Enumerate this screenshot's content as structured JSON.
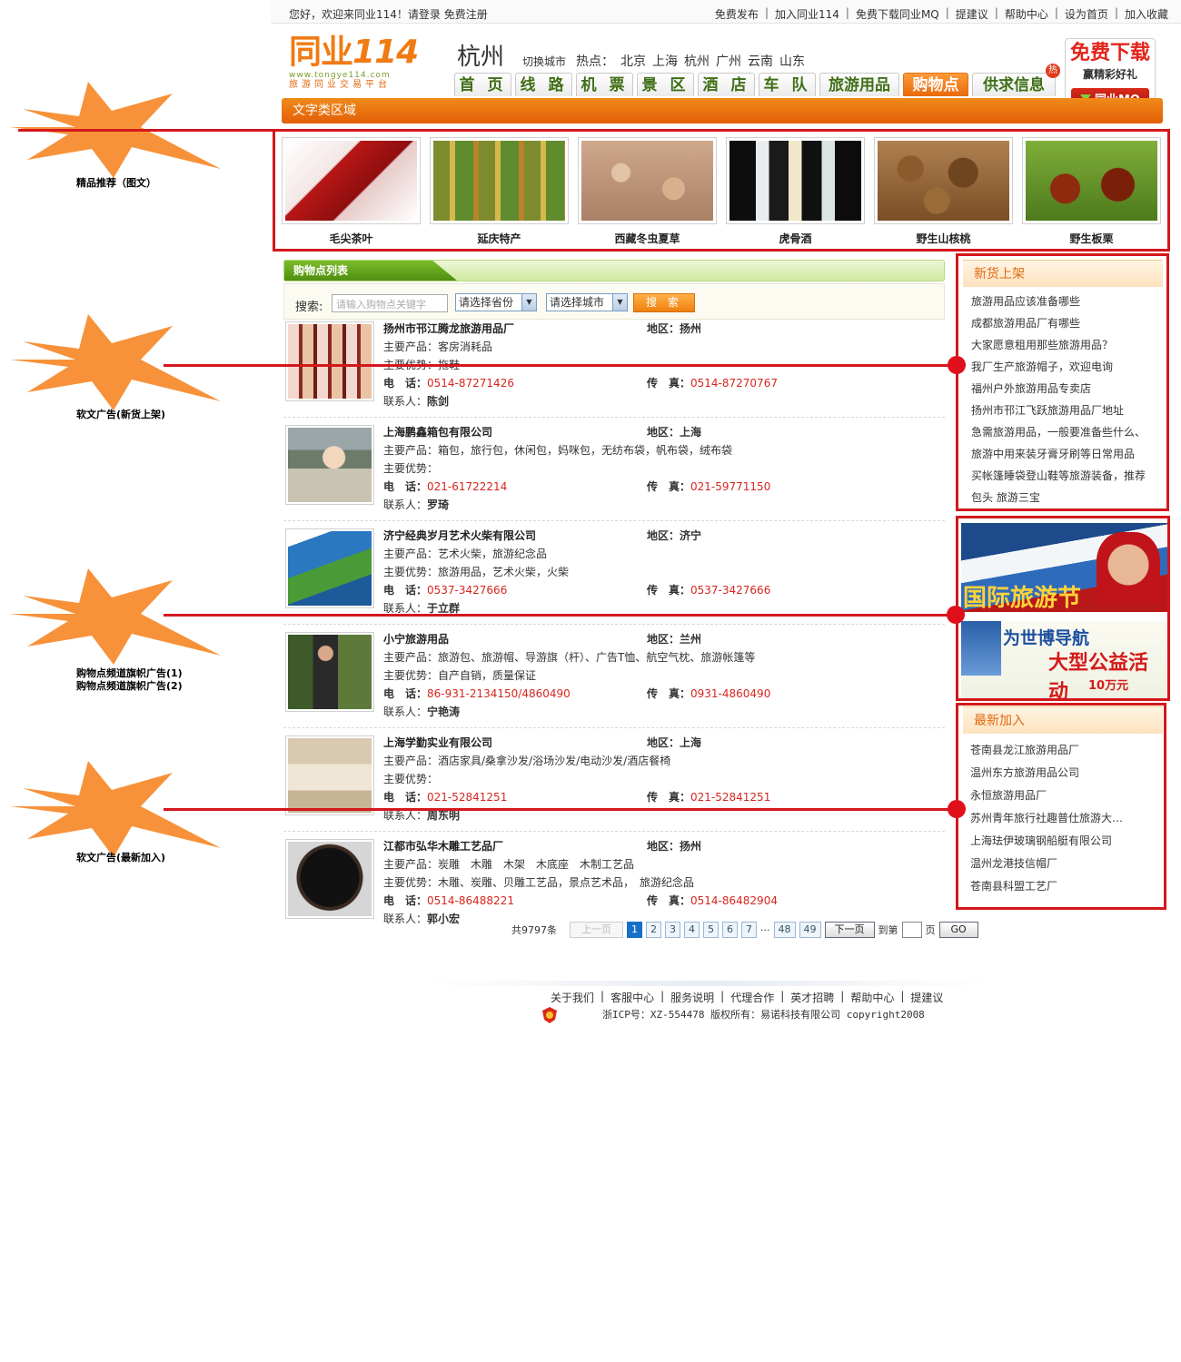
{
  "annotations": [
    {
      "label": "精品推荐（图文）"
    },
    {
      "label": "软文广告(新货上架)"
    },
    {
      "label": "购物点频道旗帜广告(1)"
    },
    {
      "label": "购物点频道旗帜广告(2)"
    },
    {
      "label": "软文广告(最新加入)"
    }
  ],
  "topbar": {
    "welcome": "您好，欢迎来同业114！请登录 免费注册",
    "links": [
      "免费发布",
      "加入同业114",
      "免费下载同业MQ",
      "提建议",
      "帮助中心",
      "设为首页",
      "加入收藏"
    ]
  },
  "header": {
    "logo_cn": "同业",
    "logo_num": "114",
    "logo_url": "www.tongye114.com",
    "logo_slogan": "旅游同业交易平台",
    "city": "杭州",
    "switch_city": "切换城市",
    "hot_label": "热点：",
    "hot_cities": [
      "北京",
      "上海",
      "杭州",
      "广州",
      "云南",
      "山东"
    ],
    "hot_badge": "热"
  },
  "nav": {
    "tabs": [
      "首 页",
      "线 路",
      "机 票",
      "景 区",
      "酒 店",
      "车 队",
      "旅游用品",
      "购物点",
      "供求信息"
    ],
    "active": "购物点"
  },
  "promo": {
    "title": "免费下载",
    "subtitle": "赢精彩好礼",
    "button": "同业MQ"
  },
  "text_area_title": "文字类区域",
  "featured": [
    {
      "name": "毛尖茶叶"
    },
    {
      "name": "延庆特产"
    },
    {
      "name": "西藏冬虫夏草"
    },
    {
      "name": "虎骨酒"
    },
    {
      "name": "野生山核桃"
    },
    {
      "name": "野生板栗"
    }
  ],
  "list": {
    "title": "购物点列表",
    "search_label": "搜索:",
    "search_placeholder": "请输入购物点关键字",
    "province_select": "请选择省份",
    "city_select": "请选择城市",
    "search_button": "搜 索",
    "labels": {
      "region": "地区：",
      "products": "主要产品：",
      "advantage": "主要优势：",
      "phone": "电　话：",
      "fax": "传　真：",
      "contact": "联系人："
    },
    "items": [
      {
        "name": "扬州市邗江腾龙旅游用品厂",
        "region": "扬州",
        "products": "客房消耗品",
        "advantage": "拖鞋",
        "phone": "0514-87271426",
        "fax": "0514-87270767",
        "contact": "陈剑"
      },
      {
        "name": "上海鹏鑫箱包有限公司",
        "region": "上海",
        "products": "箱包，旅行包，休闲包，妈咪包，无纺布袋，帆布袋，绒布袋",
        "advantage": "",
        "phone": "021-61722214",
        "fax": "021-59771150",
        "contact": "罗琦"
      },
      {
        "name": "济宁经典岁月艺术火柴有限公司",
        "region": "济宁",
        "products": "艺术火柴，旅游纪念品",
        "advantage": "旅游用品，艺术火柴，火柴",
        "phone": "0537-3427666",
        "fax": "0537-3427666",
        "contact": "于立群"
      },
      {
        "name": "小宁旅游用品",
        "region": "兰州",
        "products": "旅游包、旅游帽、导游旗（杆）、广告T恤、航空气枕、旅游帐篷等",
        "advantage": "自产自销，质量保证",
        "phone": "86-931-2134150/4860490",
        "fax": "0931-4860490",
        "contact": "宁艳涛"
      },
      {
        "name": "上海学勤实业有限公司",
        "region": "上海",
        "products": "酒店家具/桑拿沙发/浴场沙发/电动沙发/酒店餐椅",
        "advantage": "",
        "phone": "021-52841251",
        "fax": "021-52841251",
        "contact": "周东明"
      },
      {
        "name": "江都市弘华木雕工艺品厂",
        "region": "扬州",
        "products": "炭雕　木雕　木架　木底座　木制工艺品",
        "advantage": "木雕、炭雕、贝雕工艺品，景点艺术品，　旅游纪念品",
        "phone": "0514-86488221",
        "fax": "0514-86482904",
        "contact": "郭小宏"
      }
    ]
  },
  "sidebar": {
    "new_goods": {
      "title": "新货上架",
      "items": [
        "旅游用品应该准备哪些",
        "成都旅游用品厂有哪些",
        "大家愿意租用那些旅游用品？",
        "我厂生产旅游帽子，欢迎电询",
        "福州户外旅游用品专卖店",
        "扬州市邗江飞跃旅游用品厂地址",
        "急需旅游用品，一般要准备些什么、",
        "旅游中用来装牙膏牙刷等日常用品",
        "买帐篷睡袋登山鞋等旅游装备，推荐",
        "包头 旅游三宝"
      ]
    },
    "banner1": {
      "text": "国际旅游节"
    },
    "banner2": {
      "text1": "为世博导航",
      "text2": "大型公益活动",
      "text3": "10万元"
    },
    "new_join": {
      "title": "最新加入",
      "items": [
        "苍南县龙江旅游用品厂",
        "温州东方旅游用品公司",
        "永恒旅游用品厂",
        "苏州青年旅行社趣普仕旅游大…",
        "上海珐伊玻璃钢船艇有限公司",
        "温州龙港技信帽厂",
        "苍南县科盟工艺厂"
      ]
    }
  },
  "pager": {
    "total": "共9797条",
    "prev": "上一页",
    "pages": [
      "1",
      "2",
      "3",
      "4",
      "5",
      "6",
      "7"
    ],
    "ellipsis": "···",
    "tail_pages": [
      "48",
      "49"
    ],
    "next": "下一页",
    "goto_pre": "到第",
    "goto_post": "页",
    "go": "GO",
    "current": 1
  },
  "footer": {
    "links": [
      "关于我们",
      "客服中心",
      "服务说明",
      "代理合作",
      "英才招聘",
      "帮助中心",
      "提建议"
    ],
    "copyright": "浙ICP号：XZ-554478 版权所有：易诺科技有限公司 copyright2008"
  },
  "colors": {
    "accent_orange": "#e86a0a",
    "nav_green": "#3f6f16",
    "annotation_red": "#d4171c",
    "price_red": "#d7261e"
  }
}
